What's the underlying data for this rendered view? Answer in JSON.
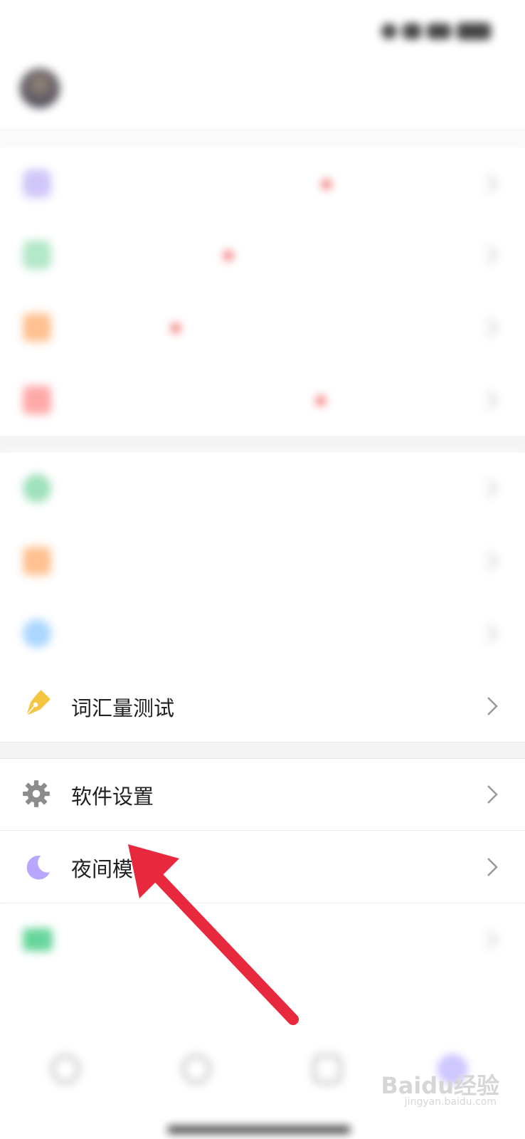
{
  "status": {
    "time": ""
  },
  "profile": {
    "name": ""
  },
  "group1": [
    {
      "label": "",
      "icon": "crown-icon",
      "color": "#b6a6f5"
    },
    {
      "label": "",
      "icon": "vip-icon",
      "color": "#6fd49a"
    },
    {
      "label": "",
      "icon": "bookmark-icon",
      "color": "#ffa15a"
    },
    {
      "label": "",
      "icon": "share-icon",
      "color": "#ff7b7b"
    }
  ],
  "group2": [
    {
      "label": "",
      "icon": "list-icon",
      "color": "#6fd49a"
    },
    {
      "label": "",
      "icon": "note-icon",
      "color": "#ffa15a"
    },
    {
      "label": "",
      "icon": "record-icon",
      "color": "#7fbfff"
    },
    {
      "label": "词汇量测试",
      "icon": "pen-icon",
      "color": "#f5c542"
    }
  ],
  "group3": [
    {
      "label": "软件设置",
      "icon": "gear-icon",
      "color": "#8c8c8c"
    },
    {
      "label": "夜间模",
      "icon": "moon-icon",
      "color": "#b9a6ff"
    },
    {
      "label": "",
      "icon": "feedback-icon",
      "color": "#4ccf8a"
    }
  ],
  "logout": {
    "label": ""
  },
  "tabs": [
    {
      "label": ""
    },
    {
      "label": ""
    },
    {
      "label": ""
    },
    {
      "label": ""
    }
  ],
  "watermark": {
    "brand": "Baidu经验",
    "url": "jingyan.baidu.com"
  }
}
